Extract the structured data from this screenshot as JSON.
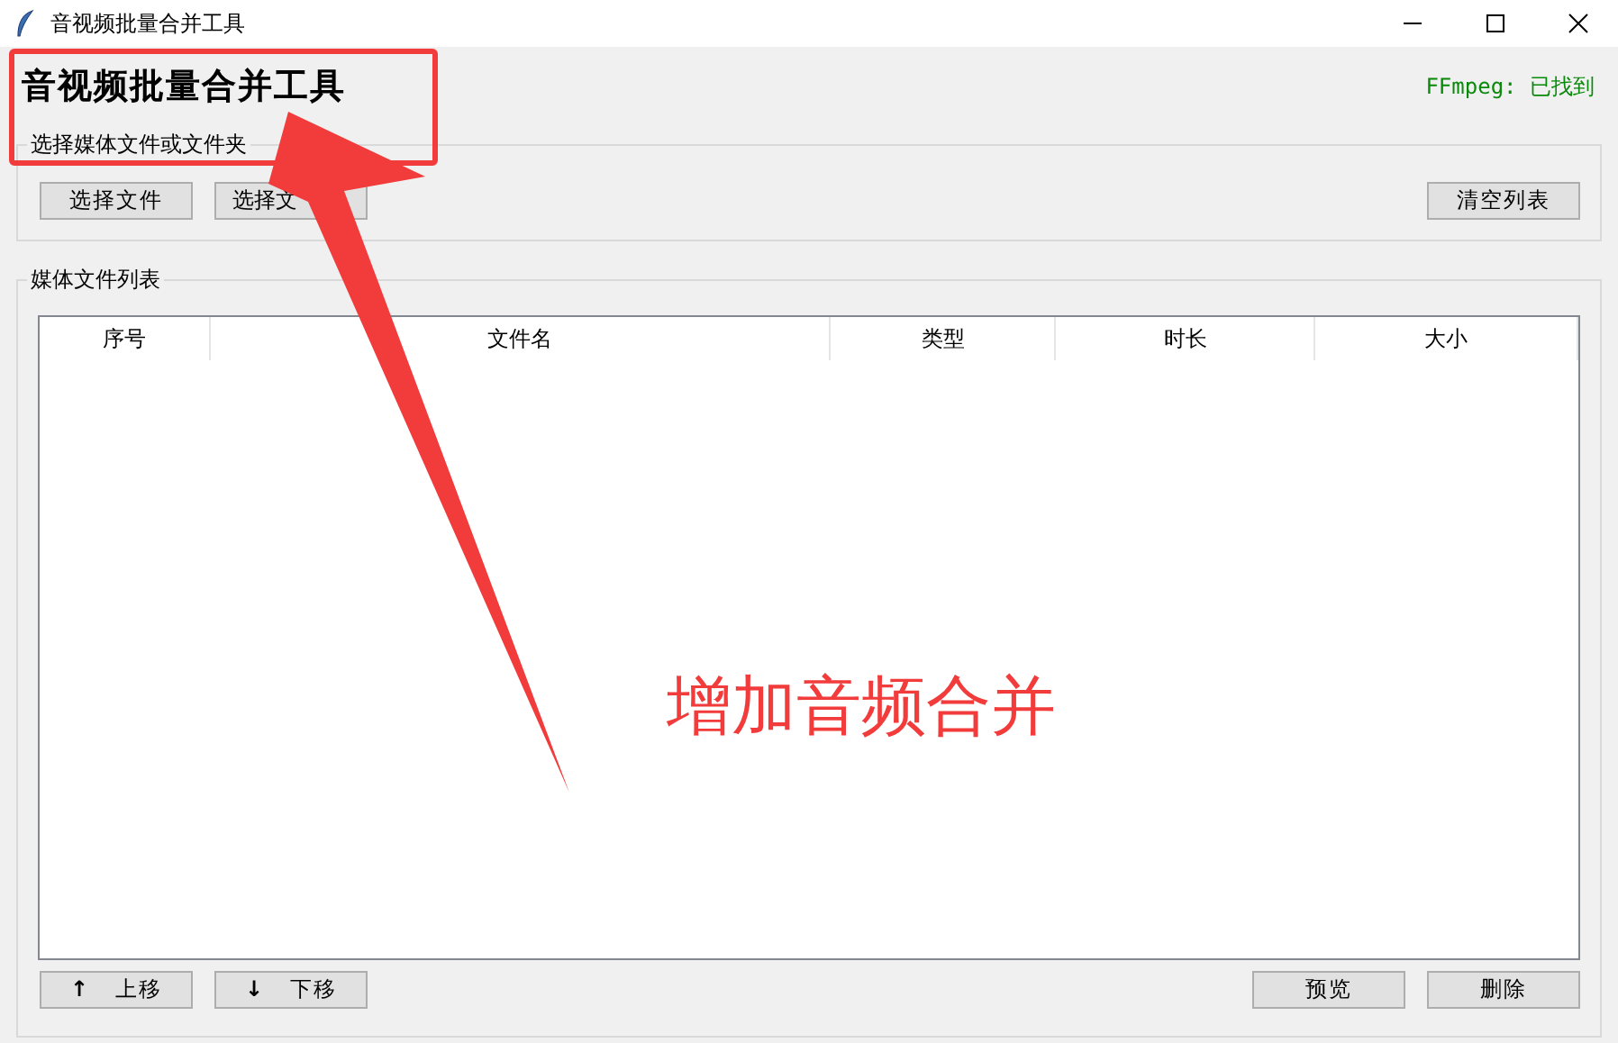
{
  "window": {
    "title": "音视频批量合并工具"
  },
  "heading": "音视频批量合并工具",
  "ffmpeg_status": "FFmpeg: 已找到",
  "select_group": {
    "label": "选择媒体文件或文件夹",
    "buttons": [
      "选择文件",
      "选择文"
    ],
    "clear_button": "清空列表"
  },
  "list_group": {
    "label": "媒体文件列表",
    "columns": [
      "序号",
      "文件名",
      "类型",
      "时长",
      "大小"
    ]
  },
  "bottom_buttons": {
    "left": [
      {
        "icon": "↑",
        "label": "上移"
      },
      {
        "icon": "↓",
        "label": "下移"
      }
    ],
    "right": [
      "预览",
      "删除"
    ]
  },
  "annotation": {
    "text": "增加音频合并"
  }
}
